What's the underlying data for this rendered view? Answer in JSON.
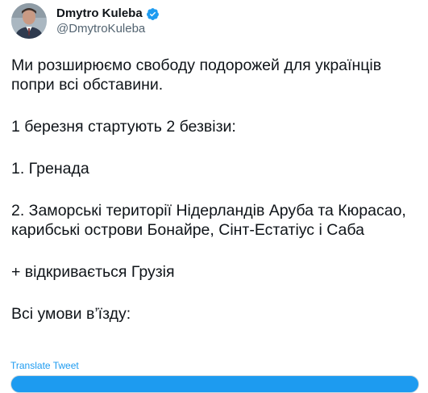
{
  "author": {
    "name": "Dmytro Kuleba",
    "handle": "@DmytroKuleba",
    "verified": true,
    "verified_icon": "verified-badge-icon"
  },
  "tweet": {
    "paragraphs": [
      "Ми розширюємо свободу подорожей для українців попри всі обставини.",
      "1 березня стартують 2 безвізи:",
      "1. Гренада",
      "2. Заморські території Нідерландів Аруба та Кюрасао, карибські острови Бонайре, Сінт-Естатіус і Саба",
      "+ відкривається Грузія",
      "Всі умови в’їзду:"
    ]
  },
  "actions": {
    "translate_label": "Translate Tweet"
  },
  "colors": {
    "accent": "#1d9bf0",
    "text": "#0f1419",
    "secondary_text": "#536471"
  }
}
